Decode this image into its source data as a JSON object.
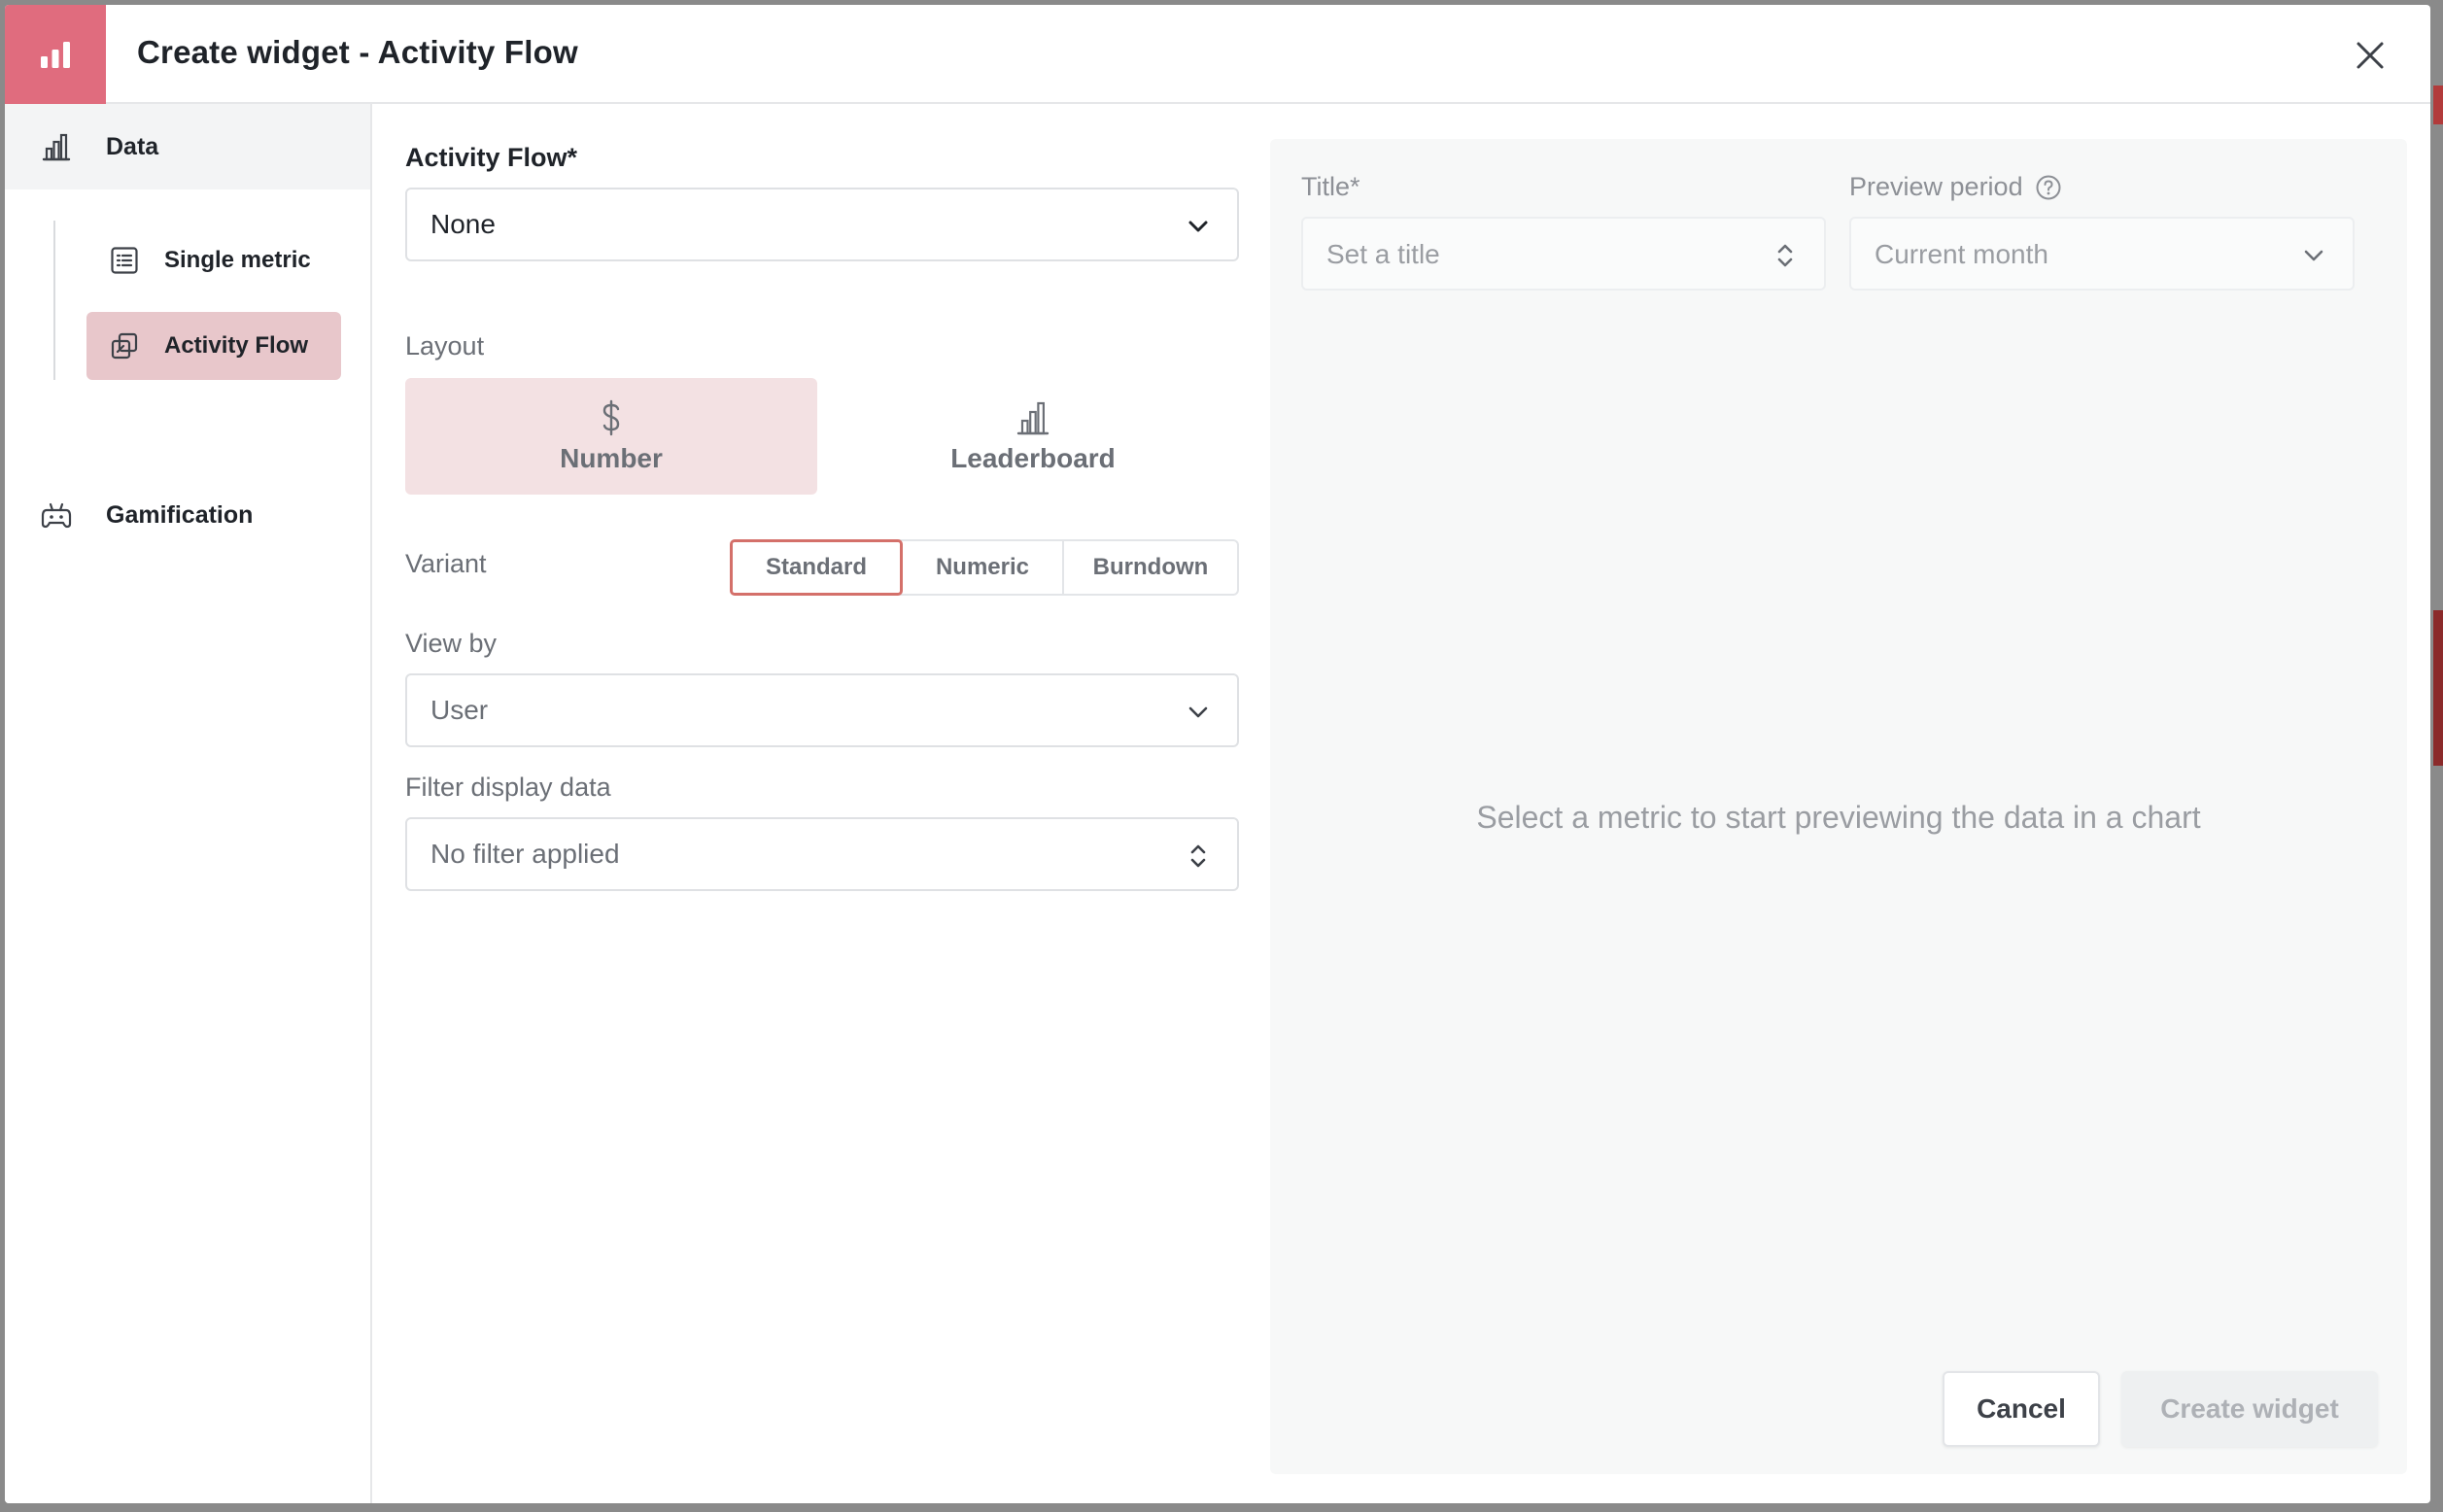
{
  "header": {
    "title": "Create widget - Activity Flow",
    "logo_icon": "bar-chart-icon",
    "close_icon": "close-icon"
  },
  "sidebar": {
    "data_item": {
      "label": "Data",
      "icon": "bar-chart-outline-icon"
    },
    "sub_items": [
      {
        "label": "Single metric",
        "icon": "list-box-icon",
        "active": false
      },
      {
        "label": "Activity Flow",
        "icon": "copy-stack-icon",
        "active": true
      }
    ],
    "gamification": {
      "label": "Gamification",
      "icon": "gamepad-icon"
    }
  },
  "form": {
    "activity_flow_label": "Activity Flow*",
    "activity_flow_value": "None",
    "layout_label": "Layout",
    "layout_options": [
      {
        "label": "Number",
        "icon": "dollar-icon",
        "selected": true
      },
      {
        "label": "Leaderboard",
        "icon": "bar-chart-outline-icon",
        "selected": false
      }
    ],
    "variant_label": "Variant",
    "variants": [
      {
        "label": "Standard",
        "selected": true
      },
      {
        "label": "Numeric",
        "selected": false
      },
      {
        "label": "Burndown",
        "selected": false
      }
    ],
    "view_by_label": "View by",
    "view_by_value": "User",
    "filter_label": "Filter display data",
    "filter_value": "No filter applied"
  },
  "preview": {
    "title_label": "Title*",
    "title_placeholder": "Set a title",
    "period_label": "Preview period",
    "period_value": "Current month",
    "empty_message": "Select a metric to start previewing the data in a chart"
  },
  "actions": {
    "cancel_label": "Cancel",
    "create_label": "Create widget"
  },
  "colors": {
    "accent": "#e06c7e",
    "active_bg": "#e8c7cb",
    "selected_variant_border": "#d4706a"
  }
}
